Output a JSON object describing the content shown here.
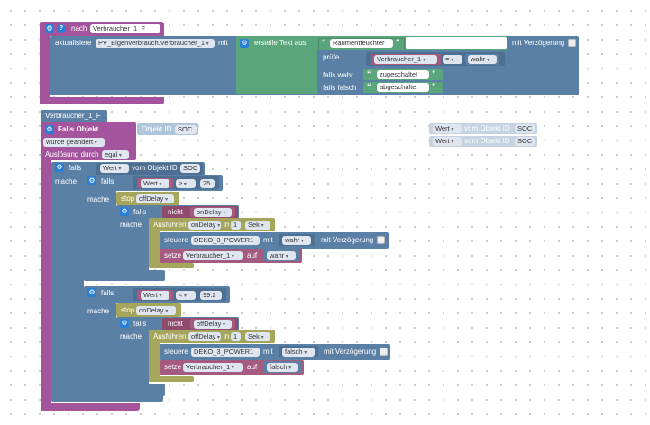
{
  "block1": {
    "nach_label": "nach",
    "nach_var": "Verbraucher_1_F",
    "aktualisiere_label": "aktualisiere",
    "aktualisiere_target": "PV_Eigenverbrauch.Verbraucher_1",
    "mit_label": "mit",
    "erstelle_label": "erstelle Text aus",
    "text1": "Raumentfeuchter",
    "pruefe_label": "prüfe",
    "cmp_var": "Verbraucher_1",
    "cmp_op": "=",
    "cmp_val": "wahr",
    "falls_wahr_label": "falls wahr",
    "falls_wahr_text": "zugeschaltet",
    "falls_falsch_label": "falls falsch",
    "falls_falsch_text": "abgeschaltet",
    "delay_label": "mit Verzögerung"
  },
  "block2": {
    "title": "Verbraucher_1_F",
    "falls_objekt": "Falls Objekt",
    "objekt_id_label": "Objekt ID",
    "objekt_id_value": "SOC",
    "wurde": "wurde geändert",
    "ausloesung_label": "Auslösung durch",
    "ausloesung_value": "egal",
    "falls": "falls",
    "mache": "mache",
    "wert": "Wert",
    "vom_objekt": "vom Objekt ID",
    "soc": "SOC",
    "ge_op": "≥",
    "ge_val": "25",
    "lt_op": "<",
    "lt_val": "99.2",
    "stop": "stop",
    "offDelay": "offDelay",
    "onDelay": "onDelay",
    "nicht": "nicht",
    "ausfuehren": "Ausführen",
    "in": "in",
    "one": "1",
    "sek": "Sek",
    "steuere": "steuere",
    "device": "DEKO_3_POWER1",
    "mit": "mit",
    "wahr": "wahr",
    "falsch": "falsch",
    "mit_verz": "mit Verzögerung",
    "setze": "setze",
    "var": "Verbraucher_1",
    "auf": "auf"
  },
  "floating": {
    "wert": "Wert",
    "vom_objekt": "vom Objekt ID",
    "soc": "SOC"
  },
  "icons": [
    "gear-icon",
    "help-icon",
    "quote-icon",
    "checkbox"
  ]
}
